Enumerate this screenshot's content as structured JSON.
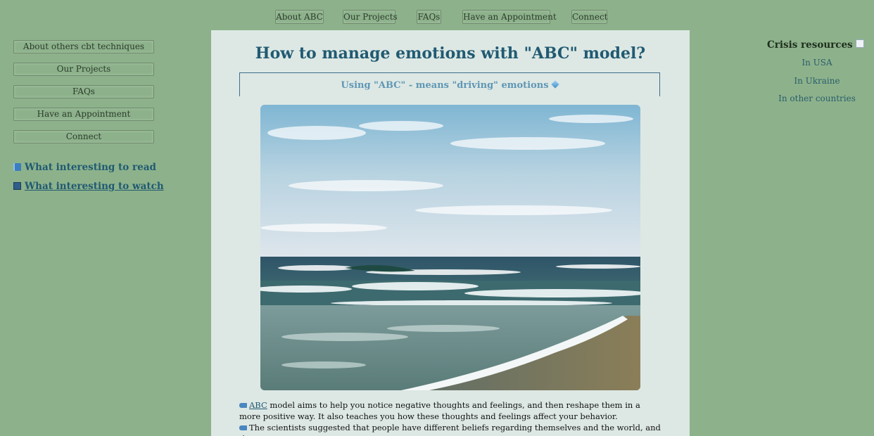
{
  "top_nav": [
    {
      "label": "About ABC"
    },
    {
      "label": "Our Projects"
    },
    {
      "label": "FAQs"
    },
    {
      "label": "Have an Appointment"
    },
    {
      "label": "Connect"
    }
  ],
  "sidebar": {
    "buttons": [
      {
        "label": "About others cbt techniques"
      },
      {
        "label": "Our Projects"
      },
      {
        "label": "FAQs"
      },
      {
        "label": "Have an Appointment"
      },
      {
        "label": "Connect"
      }
    ],
    "read_link": "What interesting to read",
    "watch_link": "What interesting to watch"
  },
  "main": {
    "title": "How to manage emotions with \"ABC\" model?",
    "subtitle": "Using \"ABC\" - means \"driving\" emotions",
    "abc_link": "ABC",
    "para1": " model aims to help you notice negative thoughts and feelings, and then reshape them in a more positive way. It also teaches you how these thoughts and feelings affect your behavior.",
    "para2": "The scientists suggested that people have different beliefs regarding themselves and the world, and these"
  },
  "crisis": {
    "title": "Crisis resources",
    "links": [
      "In USA",
      "In Ukraine",
      "In other countries"
    ]
  },
  "colors": {
    "page_bg": "#8db28b",
    "panel_bg": "#dde8e4",
    "heading": "#215a72"
  }
}
